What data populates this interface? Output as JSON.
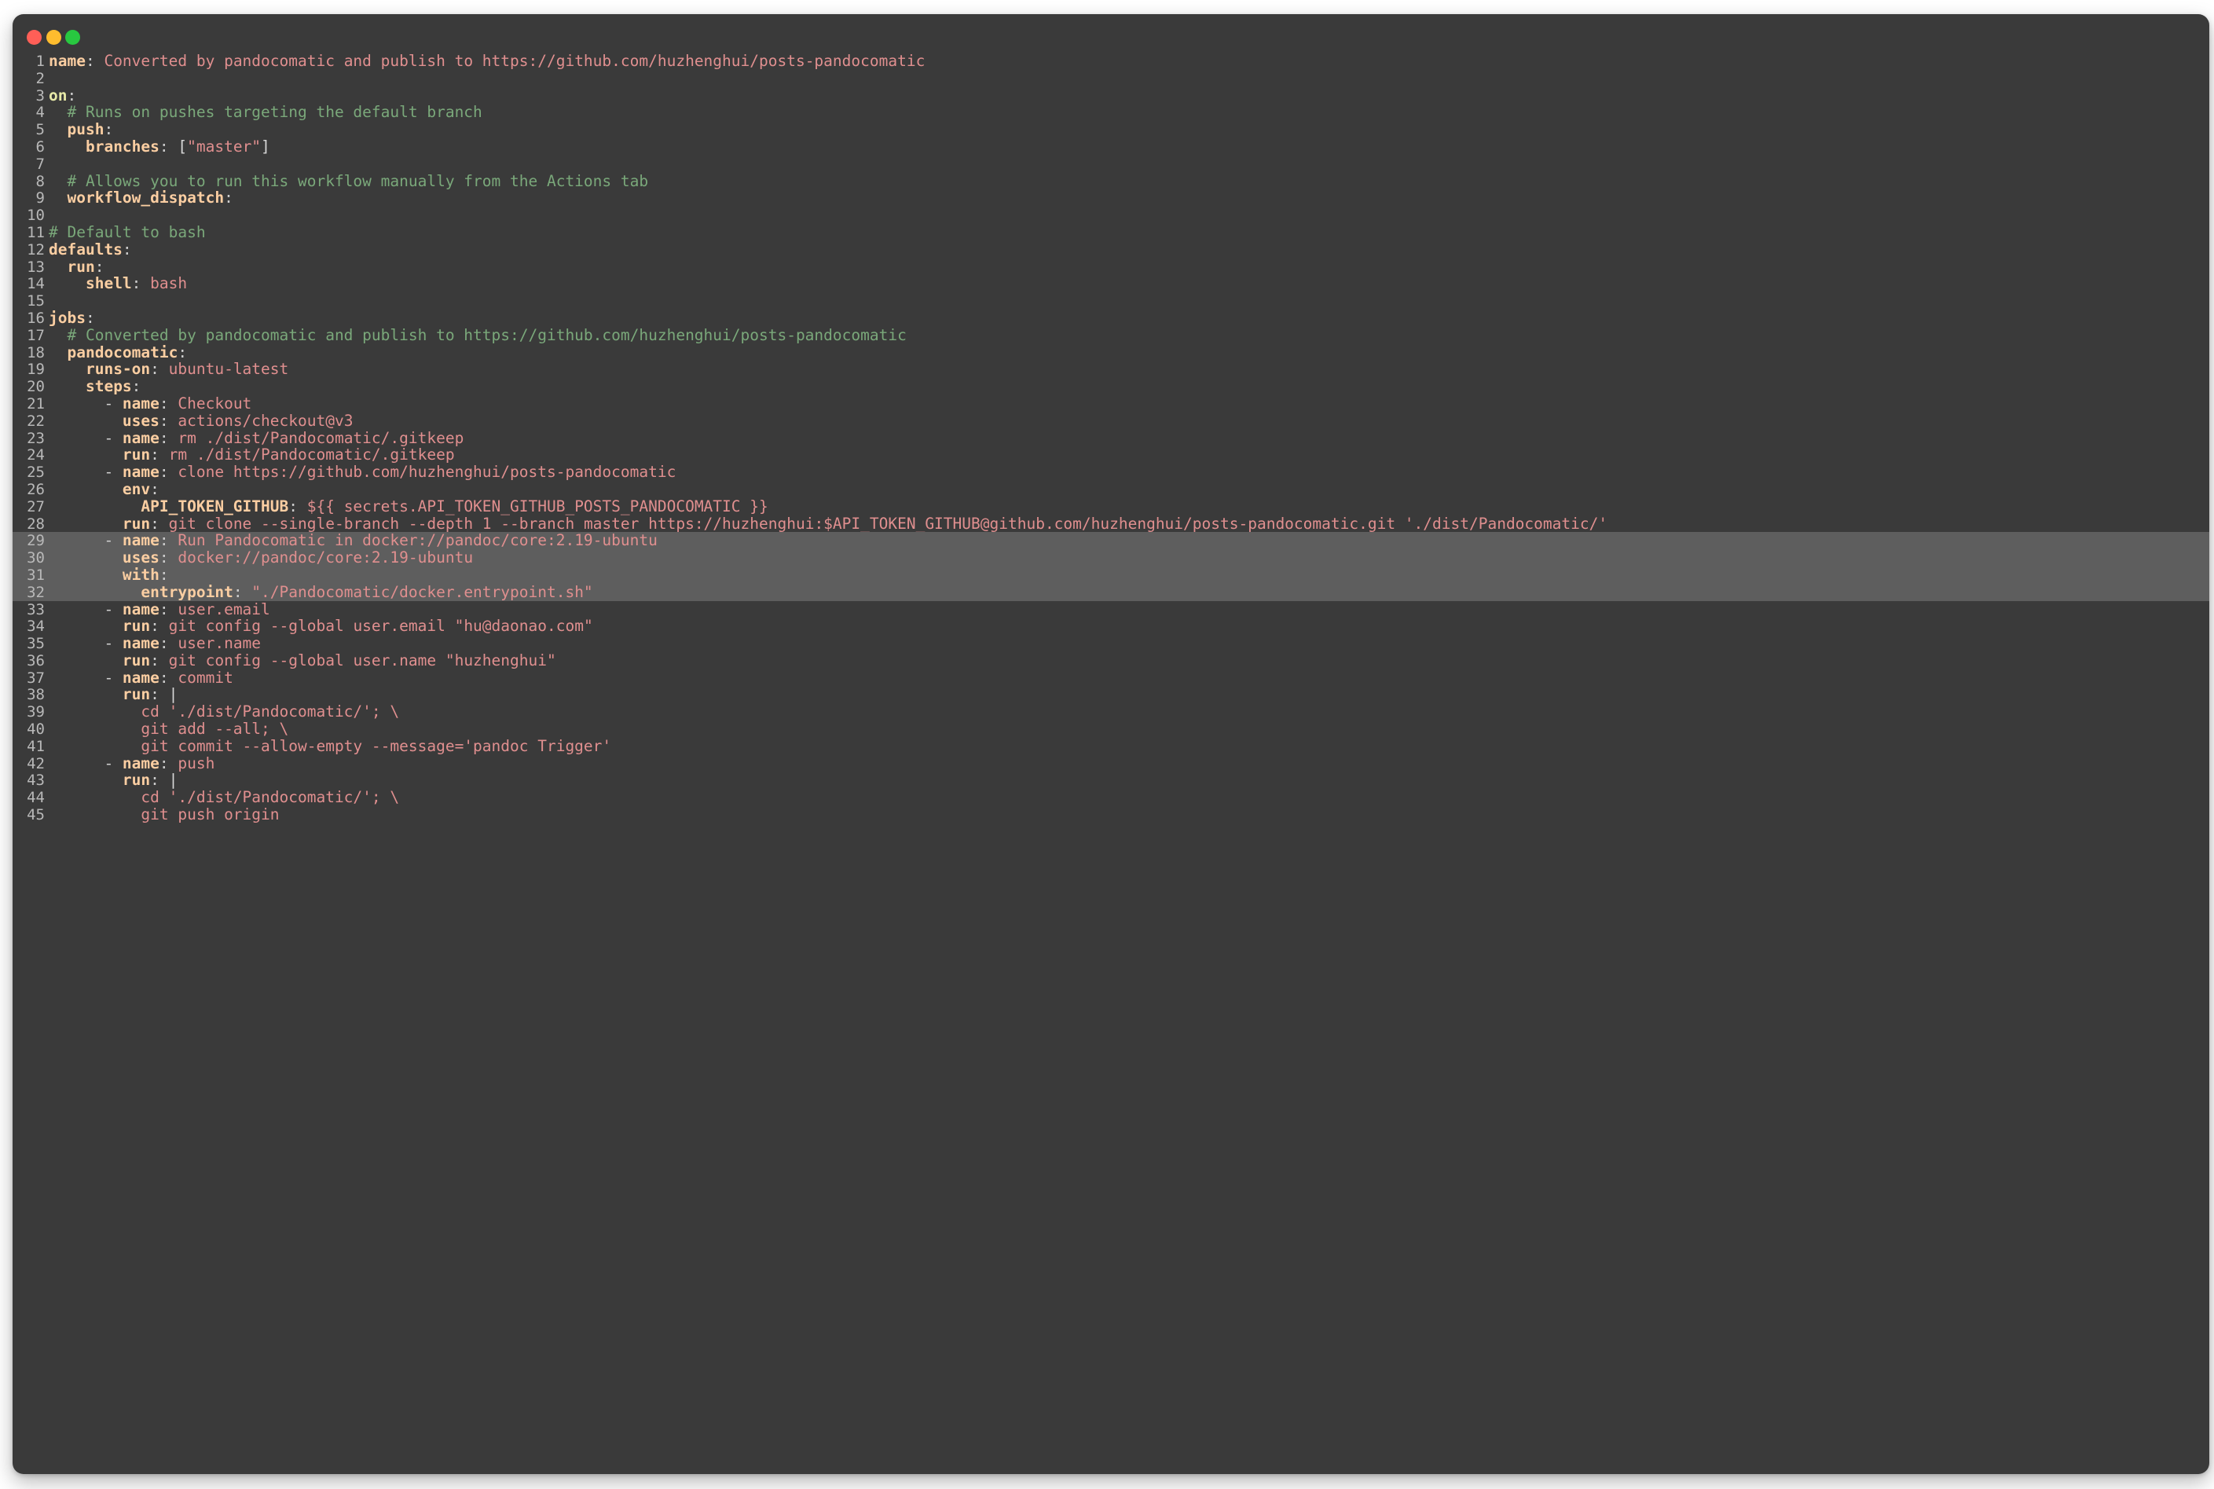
{
  "window": {
    "controls": [
      {
        "name": "close-button",
        "color": "#ff5f57"
      },
      {
        "name": "minimize-button",
        "color": "#febc2e"
      },
      {
        "name": "maximize-button",
        "color": "#28c840"
      }
    ],
    "background": "#3a3a3a",
    "highlight_background": "#5e5e5e",
    "page_background": "#ffffff"
  },
  "editor": {
    "language": "yaml",
    "highlighted_lines": [
      29,
      30,
      31,
      32
    ],
    "theme_colors": {
      "key": "#fbcea2",
      "keyword_key": "#e8eaa8",
      "string": "#e08f8f",
      "comment": "#7aa87a",
      "punctuation": "#cfcfcf",
      "line_number": "#b8b8b8"
    },
    "lines": [
      {
        "n": "1",
        "segments": [
          {
            "t": "name",
            "c": "k"
          },
          {
            "t": ": ",
            "c": "p"
          },
          {
            "t": "Converted by pandocomatic and publish to https://github.com/huzhenghui/posts-pandocomatic",
            "c": "s"
          }
        ]
      },
      {
        "n": "2",
        "segments": []
      },
      {
        "n": "3",
        "segments": [
          {
            "t": "on",
            "c": "kb"
          },
          {
            "t": ":",
            "c": "p"
          }
        ]
      },
      {
        "n": "4",
        "segments": [
          {
            "t": "  ",
            "c": "plain"
          },
          {
            "t": "# Runs on pushes targeting the default branch",
            "c": "c"
          }
        ]
      },
      {
        "n": "5",
        "segments": [
          {
            "t": "  ",
            "c": "plain"
          },
          {
            "t": "push",
            "c": "k"
          },
          {
            "t": ":",
            "c": "p"
          }
        ]
      },
      {
        "n": "6",
        "segments": [
          {
            "t": "    ",
            "c": "plain"
          },
          {
            "t": "branches",
            "c": "k"
          },
          {
            "t": ": ",
            "c": "p"
          },
          {
            "t": "[",
            "c": "plain"
          },
          {
            "t": "\"master\"",
            "c": "s"
          },
          {
            "t": "]",
            "c": "plain"
          }
        ]
      },
      {
        "n": "7",
        "segments": []
      },
      {
        "n": "8",
        "segments": [
          {
            "t": "  ",
            "c": "plain"
          },
          {
            "t": "# Allows you to run this workflow manually from the Actions tab",
            "c": "c"
          }
        ]
      },
      {
        "n": "9",
        "segments": [
          {
            "t": "  ",
            "c": "plain"
          },
          {
            "t": "workflow_dispatch",
            "c": "k"
          },
          {
            "t": ":",
            "c": "p"
          }
        ]
      },
      {
        "n": "10",
        "segments": []
      },
      {
        "n": "11",
        "segments": [
          {
            "t": "# Default to bash",
            "c": "c"
          }
        ]
      },
      {
        "n": "12",
        "segments": [
          {
            "t": "defaults",
            "c": "k"
          },
          {
            "t": ":",
            "c": "p"
          }
        ]
      },
      {
        "n": "13",
        "segments": [
          {
            "t": "  ",
            "c": "plain"
          },
          {
            "t": "run",
            "c": "k"
          },
          {
            "t": ":",
            "c": "p"
          }
        ]
      },
      {
        "n": "14",
        "segments": [
          {
            "t": "    ",
            "c": "plain"
          },
          {
            "t": "shell",
            "c": "k"
          },
          {
            "t": ": ",
            "c": "p"
          },
          {
            "t": "bash",
            "c": "s"
          }
        ]
      },
      {
        "n": "15",
        "segments": []
      },
      {
        "n": "16",
        "segments": [
          {
            "t": "jobs",
            "c": "k"
          },
          {
            "t": ":",
            "c": "p"
          }
        ]
      },
      {
        "n": "17",
        "segments": [
          {
            "t": "  ",
            "c": "plain"
          },
          {
            "t": "# Converted by pandocomatic and publish to https://github.com/huzhenghui/posts-pandocomatic",
            "c": "c"
          }
        ]
      },
      {
        "n": "18",
        "segments": [
          {
            "t": "  ",
            "c": "plain"
          },
          {
            "t": "pandocomatic",
            "c": "k"
          },
          {
            "t": ":",
            "c": "p"
          }
        ]
      },
      {
        "n": "19",
        "segments": [
          {
            "t": "    ",
            "c": "plain"
          },
          {
            "t": "runs-on",
            "c": "k"
          },
          {
            "t": ": ",
            "c": "p"
          },
          {
            "t": "ubuntu-latest",
            "c": "s"
          }
        ]
      },
      {
        "n": "20",
        "segments": [
          {
            "t": "    ",
            "c": "plain"
          },
          {
            "t": "steps",
            "c": "k"
          },
          {
            "t": ":",
            "c": "p"
          }
        ]
      },
      {
        "n": "21",
        "segments": [
          {
            "t": "      - ",
            "c": "p"
          },
          {
            "t": "name",
            "c": "k"
          },
          {
            "t": ": ",
            "c": "p"
          },
          {
            "t": "Checkout",
            "c": "s"
          }
        ]
      },
      {
        "n": "22",
        "segments": [
          {
            "t": "        ",
            "c": "plain"
          },
          {
            "t": "uses",
            "c": "k"
          },
          {
            "t": ": ",
            "c": "p"
          },
          {
            "t": "actions/checkout@v3",
            "c": "s"
          }
        ]
      },
      {
        "n": "23",
        "segments": [
          {
            "t": "      - ",
            "c": "p"
          },
          {
            "t": "name",
            "c": "k"
          },
          {
            "t": ": ",
            "c": "p"
          },
          {
            "t": "rm ./dist/Pandocomatic/.gitkeep",
            "c": "s"
          }
        ]
      },
      {
        "n": "24",
        "segments": [
          {
            "t": "        ",
            "c": "plain"
          },
          {
            "t": "run",
            "c": "k"
          },
          {
            "t": ": ",
            "c": "p"
          },
          {
            "t": "rm ./dist/Pandocomatic/.gitkeep",
            "c": "s"
          }
        ]
      },
      {
        "n": "25",
        "segments": [
          {
            "t": "      - ",
            "c": "p"
          },
          {
            "t": "name",
            "c": "k"
          },
          {
            "t": ": ",
            "c": "p"
          },
          {
            "t": "clone https://github.com/huzhenghui/posts-pandocomatic",
            "c": "s"
          }
        ]
      },
      {
        "n": "26",
        "segments": [
          {
            "t": "        ",
            "c": "plain"
          },
          {
            "t": "env",
            "c": "k"
          },
          {
            "t": ":",
            "c": "p"
          }
        ]
      },
      {
        "n": "27",
        "segments": [
          {
            "t": "          ",
            "c": "plain"
          },
          {
            "t": "API_TOKEN_GITHUB",
            "c": "k"
          },
          {
            "t": ": ",
            "c": "p"
          },
          {
            "t": "${{ secrets.API_TOKEN_GITHUB_POSTS_PANDOCOMATIC }}",
            "c": "s"
          }
        ]
      },
      {
        "n": "28",
        "segments": [
          {
            "t": "        ",
            "c": "plain"
          },
          {
            "t": "run",
            "c": "k"
          },
          {
            "t": ": ",
            "c": "p"
          },
          {
            "t": "git clone --single-branch --depth 1 --branch master https://huzhenghui:$API_TOKEN_GITHUB@github.com/huzhenghui/posts-pandocomatic.git './dist/Pandocomatic/'",
            "c": "s"
          }
        ]
      },
      {
        "n": "29",
        "segments": [
          {
            "t": "      - ",
            "c": "p"
          },
          {
            "t": "name",
            "c": "k"
          },
          {
            "t": ": ",
            "c": "p"
          },
          {
            "t": "Run Pandocomatic in docker://pandoc/core:2.19-ubuntu",
            "c": "s"
          }
        ]
      },
      {
        "n": "30",
        "segments": [
          {
            "t": "        ",
            "c": "plain"
          },
          {
            "t": "uses",
            "c": "k"
          },
          {
            "t": ": ",
            "c": "p"
          },
          {
            "t": "docker://pandoc/core:2.19-ubuntu",
            "c": "s"
          }
        ]
      },
      {
        "n": "31",
        "segments": [
          {
            "t": "        ",
            "c": "plain"
          },
          {
            "t": "with",
            "c": "k"
          },
          {
            "t": ":",
            "c": "p"
          }
        ]
      },
      {
        "n": "32",
        "segments": [
          {
            "t": "          ",
            "c": "plain"
          },
          {
            "t": "entrypoint",
            "c": "k"
          },
          {
            "t": ": ",
            "c": "p"
          },
          {
            "t": "\"./Pandocomatic/docker.entrypoint.sh\"",
            "c": "s"
          }
        ]
      },
      {
        "n": "33",
        "segments": [
          {
            "t": "      - ",
            "c": "p"
          },
          {
            "t": "name",
            "c": "k"
          },
          {
            "t": ": ",
            "c": "p"
          },
          {
            "t": "user.email",
            "c": "s"
          }
        ]
      },
      {
        "n": "34",
        "segments": [
          {
            "t": "        ",
            "c": "plain"
          },
          {
            "t": "run",
            "c": "k"
          },
          {
            "t": ": ",
            "c": "p"
          },
          {
            "t": "git config --global user.email \"hu@daonao.com\"",
            "c": "s"
          }
        ]
      },
      {
        "n": "35",
        "segments": [
          {
            "t": "      - ",
            "c": "p"
          },
          {
            "t": "name",
            "c": "k"
          },
          {
            "t": ": ",
            "c": "p"
          },
          {
            "t": "user.name",
            "c": "s"
          }
        ]
      },
      {
        "n": "36",
        "segments": [
          {
            "t": "        ",
            "c": "plain"
          },
          {
            "t": "run",
            "c": "k"
          },
          {
            "t": ": ",
            "c": "p"
          },
          {
            "t": "git config --global user.name \"huzhenghui\"",
            "c": "s"
          }
        ]
      },
      {
        "n": "37",
        "segments": [
          {
            "t": "      - ",
            "c": "p"
          },
          {
            "t": "name",
            "c": "k"
          },
          {
            "t": ": ",
            "c": "p"
          },
          {
            "t": "commit",
            "c": "s"
          }
        ]
      },
      {
        "n": "38",
        "segments": [
          {
            "t": "        ",
            "c": "plain"
          },
          {
            "t": "run",
            "c": "k"
          },
          {
            "t": ": ",
            "c": "p"
          },
          {
            "t": "|",
            "c": "plain"
          }
        ]
      },
      {
        "n": "39",
        "segments": [
          {
            "t": "          ",
            "c": "plain"
          },
          {
            "t": "cd './dist/Pandocomatic/'; \\",
            "c": "s"
          }
        ]
      },
      {
        "n": "40",
        "segments": [
          {
            "t": "          ",
            "c": "plain"
          },
          {
            "t": "git add --all; \\",
            "c": "s"
          }
        ]
      },
      {
        "n": "41",
        "segments": [
          {
            "t": "          ",
            "c": "plain"
          },
          {
            "t": "git commit --allow-empty --message='pandoc Trigger'",
            "c": "s"
          }
        ]
      },
      {
        "n": "42",
        "segments": [
          {
            "t": "      - ",
            "c": "p"
          },
          {
            "t": "name",
            "c": "k"
          },
          {
            "t": ": ",
            "c": "p"
          },
          {
            "t": "push",
            "c": "s"
          }
        ]
      },
      {
        "n": "43",
        "segments": [
          {
            "t": "        ",
            "c": "plain"
          },
          {
            "t": "run",
            "c": "k"
          },
          {
            "t": ": ",
            "c": "p"
          },
          {
            "t": "|",
            "c": "plain"
          }
        ]
      },
      {
        "n": "44",
        "segments": [
          {
            "t": "          ",
            "c": "plain"
          },
          {
            "t": "cd './dist/Pandocomatic/'; \\",
            "c": "s"
          }
        ]
      },
      {
        "n": "45",
        "segments": [
          {
            "t": "          ",
            "c": "plain"
          },
          {
            "t": "git push origin",
            "c": "s"
          }
        ]
      }
    ]
  }
}
